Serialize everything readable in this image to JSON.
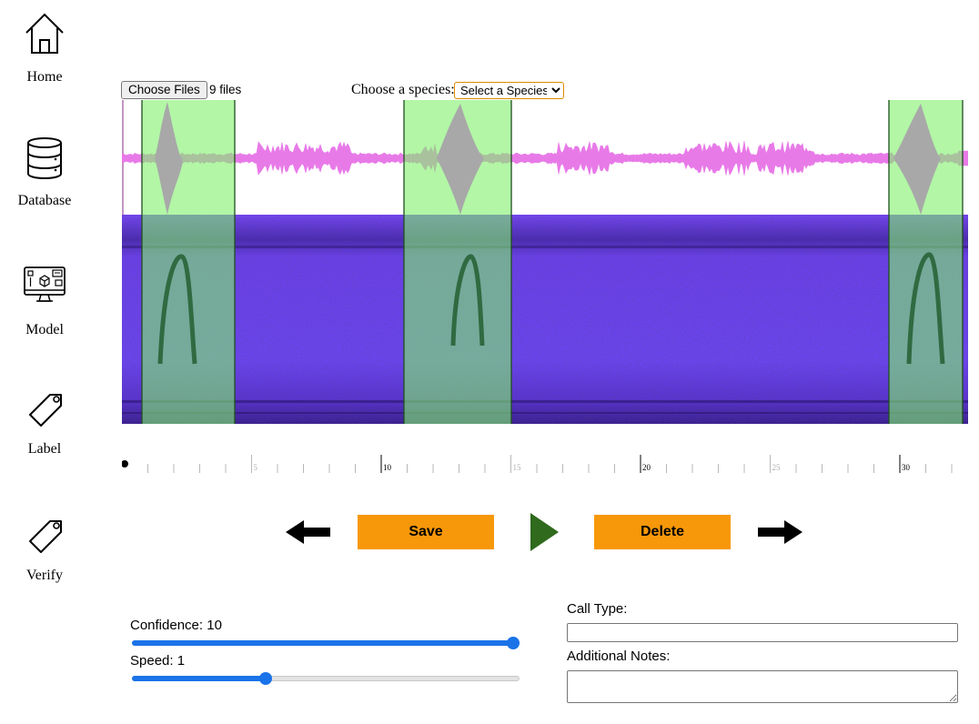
{
  "sidebar": {
    "items": [
      {
        "label": "Home",
        "icon": "home-icon"
      },
      {
        "label": "Database",
        "icon": "database-icon"
      },
      {
        "label": "Model",
        "icon": "model-monitor-icon"
      },
      {
        "label": "Label",
        "icon": "tag-icon"
      },
      {
        "label": "Verify",
        "icon": "tag-icon"
      }
    ]
  },
  "file_picker": {
    "button_label": "Choose Files",
    "status": "9 files"
  },
  "species": {
    "label": "Choose a species:",
    "selected": "Select a Species"
  },
  "timeline": {
    "major_labels": [
      "5",
      "10",
      "15",
      "20",
      "25",
      "30"
    ]
  },
  "controls": {
    "save_label": "Save",
    "delete_label": "Delete",
    "prev_icon": "arrow-left-icon",
    "next_icon": "arrow-right-icon",
    "play_icon": "play-icon"
  },
  "sliders": {
    "confidence_label": "Confidence: 10",
    "confidence_fraction": 1.0,
    "speed_label": "Speed: 1",
    "speed_fraction": 0.34
  },
  "form": {
    "call_type_label": "Call Type:",
    "call_type_value": "",
    "notes_label": "Additional Notes:",
    "notes_value": ""
  },
  "colors": {
    "accent": "#f7980a",
    "slider": "#1a73e8",
    "selection": "#99f08c",
    "waveform": "#e87ae8",
    "spectrogram": "#6a3cf0",
    "play": "#2f6a1d"
  }
}
